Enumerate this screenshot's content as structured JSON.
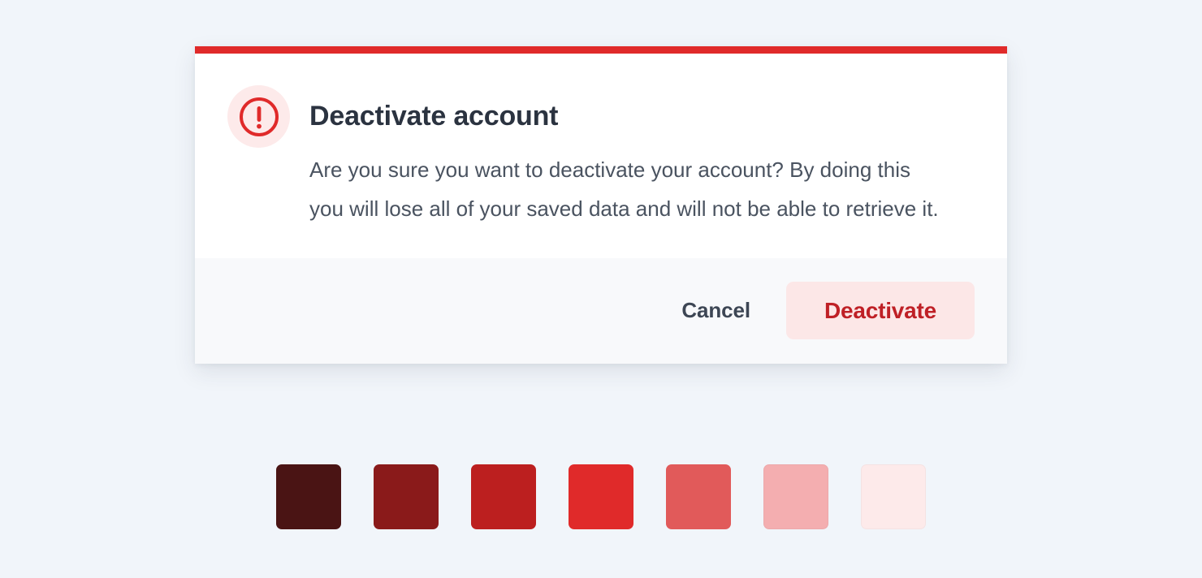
{
  "dialog": {
    "accent_color": "#e02a2a",
    "icon": {
      "name": "alert-exclamation-circle-icon",
      "stroke_color": "#e02a2a",
      "background_color": "#fdeaea"
    },
    "title": "Deactivate account",
    "message": "Are you sure you want to deactivate your account? By doing this you will lose all of your saved data and will not be able to retrieve it.",
    "footer": {
      "cancel_label": "Cancel",
      "confirm_label": "Deactivate",
      "confirm_text_color": "#bf2026",
      "confirm_background_color": "#fce7e7",
      "background_color": "#f8f9fb"
    },
    "background_color": "#ffffff"
  },
  "palette": {
    "name": "red-scale",
    "swatches": [
      {
        "name": "red-900",
        "hex": "#4a1414"
      },
      {
        "name": "red-800",
        "hex": "#8a1a1a"
      },
      {
        "name": "red-700",
        "hex": "#bc1f1f"
      },
      {
        "name": "red-600",
        "hex": "#e02a2a"
      },
      {
        "name": "red-500",
        "hex": "#e15a5a"
      },
      {
        "name": "red-300",
        "hex": "#f4aeb0"
      },
      {
        "name": "red-100",
        "hex": "#fdeaea"
      }
    ]
  },
  "page": {
    "background_color": "#f1f5fa"
  }
}
